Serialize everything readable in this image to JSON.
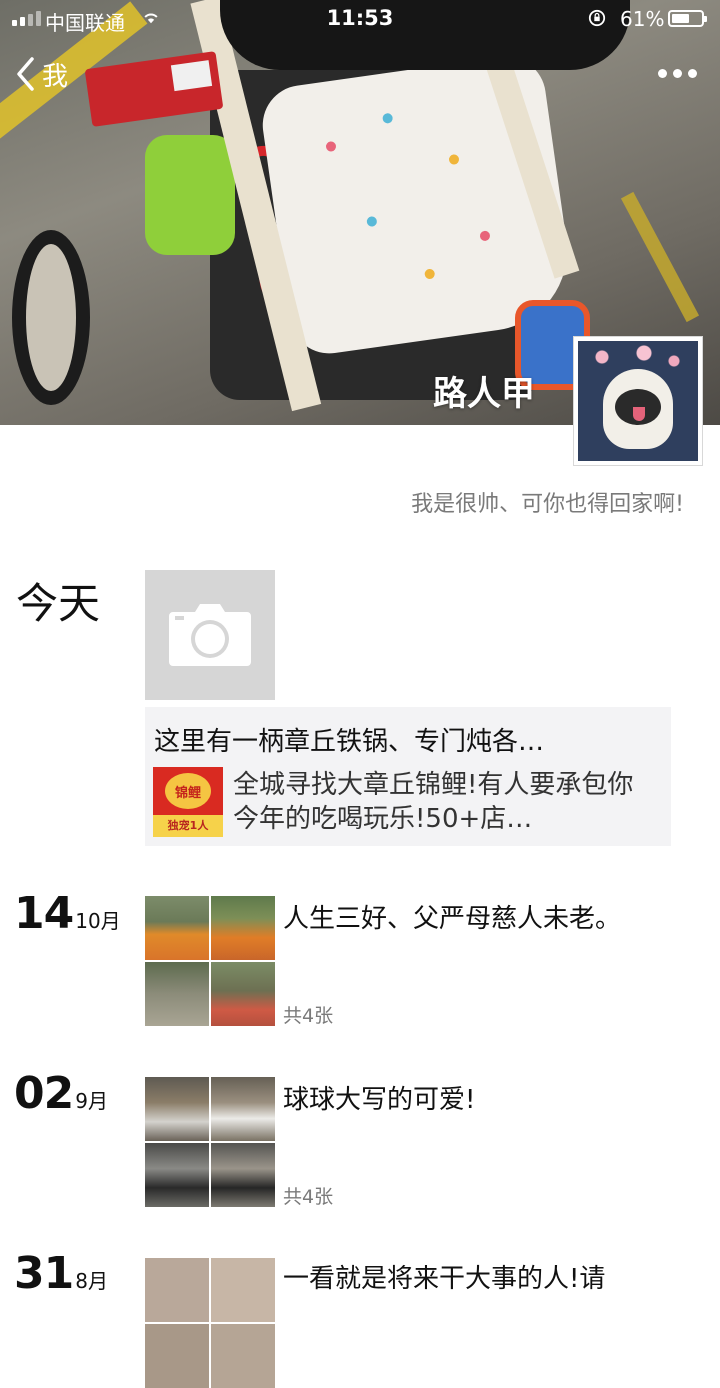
{
  "status_bar": {
    "carrier": "中国联通",
    "time": "11:53",
    "battery": "61%",
    "battery_level": 0.61
  },
  "nav": {
    "back_label": "我"
  },
  "profile": {
    "nickname": "路人甲",
    "signature": "我是很帅、可你也得回家啊!"
  },
  "today": {
    "label": "今天",
    "share": {
      "title": "这里有一柄章丘铁锅、专门炖各…",
      "description": "全城寻找大章丘锦鲤!有人要承包你今年的吃喝玩乐!50+店…",
      "thumb_top": "锦鲤",
      "thumb_bottom": "独宠1人"
    }
  },
  "posts": [
    {
      "day": "14",
      "month": "10月",
      "text": "人生三好、父严母慈人未老。",
      "count": "共4张"
    },
    {
      "day": "02",
      "month": "9月",
      "text": "球球大写的可爱!",
      "count": "共4张"
    },
    {
      "day": "31",
      "month": "8月",
      "text": "一看就是将来干大事的人!请"
    }
  ],
  "icons": [
    "back-chevron-icon",
    "more-dots-icon",
    "camera-icon",
    "wifi-icon",
    "signal-icon",
    "battery-icon",
    "orientation-lock-icon"
  ]
}
